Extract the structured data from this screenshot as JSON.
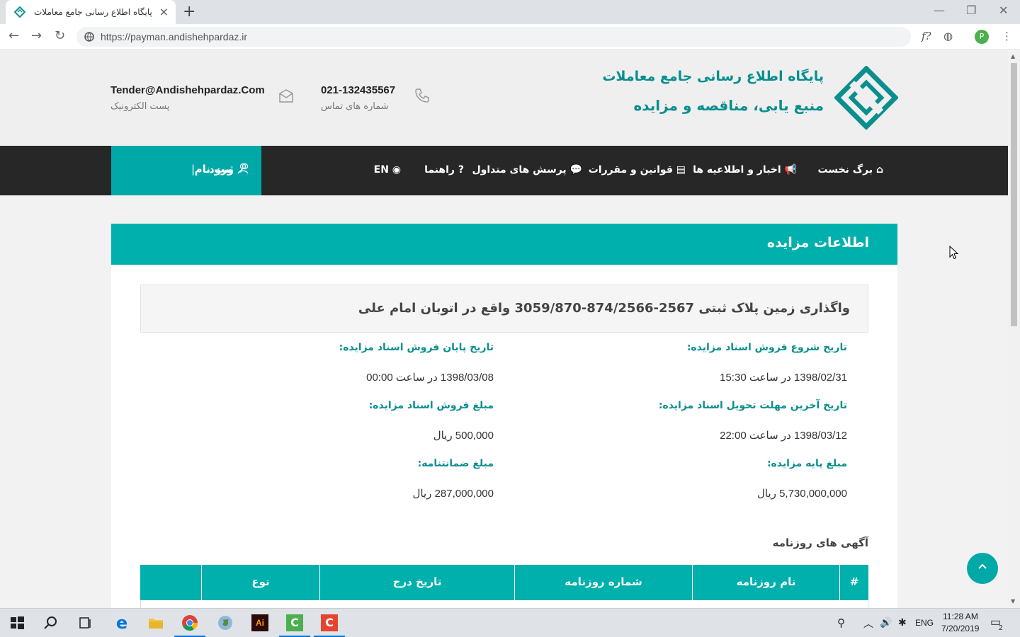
{
  "browser": {
    "tab_title": "پایگاه اطلاع رسانی جامع معاملات",
    "url": "https://payman.andishehpardaz.ir",
    "profile_initial": "P"
  },
  "header": {
    "brand_line1": "پایگاه اطلاع رسانی جامع معاملات",
    "brand_line2": "منبع یابی، مناقصه و مزایده",
    "phone": "021-132435567",
    "phone_label": "شماره های تماس",
    "email": "Tender@Andishehpardaz.Com",
    "email_label": "پست الکترونیک"
  },
  "nav": {
    "items": [
      {
        "label": "برگ نخست",
        "icon": "home-icon"
      },
      {
        "label": "اخبار و اطلاعیه ها",
        "icon": "bullhorn-icon"
      },
      {
        "label": "قوانین و مقررات",
        "icon": "book-icon"
      },
      {
        "label": "پرسش های متداول",
        "icon": "comments-icon"
      },
      {
        "label": "راهنما",
        "icon": "question-icon"
      },
      {
        "label": "EN",
        "icon": "globe-icon"
      }
    ],
    "login": "ورود",
    "register": "ثبت نام"
  },
  "auction": {
    "section_title": "اطلاعات مزایده",
    "title": "واگذاری زمین پلاک ثبتی 2567-874/2566-3059/870 واقع در اتوبان امام علی",
    "fields": {
      "start_sale_label": "تاریخ شروع فروش اسناد مزایده:",
      "start_sale_value": "1398/02/31 در ساعت 15:30",
      "end_sale_label": "تاریخ پایان فروش اسناد مزایده:",
      "end_sale_value": "1398/03/08 در ساعت 00:00",
      "deadline_label": "تاریخ آخرین مهلت تحویل اسناد مزایده:",
      "deadline_value": "1398/03/12 در ساعت 22:00",
      "doc_price_label": "مبلغ فروش اسناد مزایده:",
      "doc_price_value": "500,000 ریال",
      "base_price_label": "مبلغ پایه مزایده:",
      "base_price_value": "5,730,000,000 ریال",
      "guarantee_label": "مبلغ ضمانتنامه:",
      "guarantee_value": "287,000,000 ریال"
    },
    "ads_title": "آگهی های روزنامه",
    "table_headers": [
      "#",
      "نام روزنامه",
      "شماره روزنامه",
      "تاریخ درج",
      "نوع",
      ""
    ]
  },
  "taskbar": {
    "language": "ENG",
    "time": "11:28 AM",
    "date": "7/20/2019",
    "notif_count": "2"
  },
  "colors": {
    "accent": "#00b0ac",
    "brand_text": "#0a8e8e",
    "nav_bg": "#272727"
  }
}
